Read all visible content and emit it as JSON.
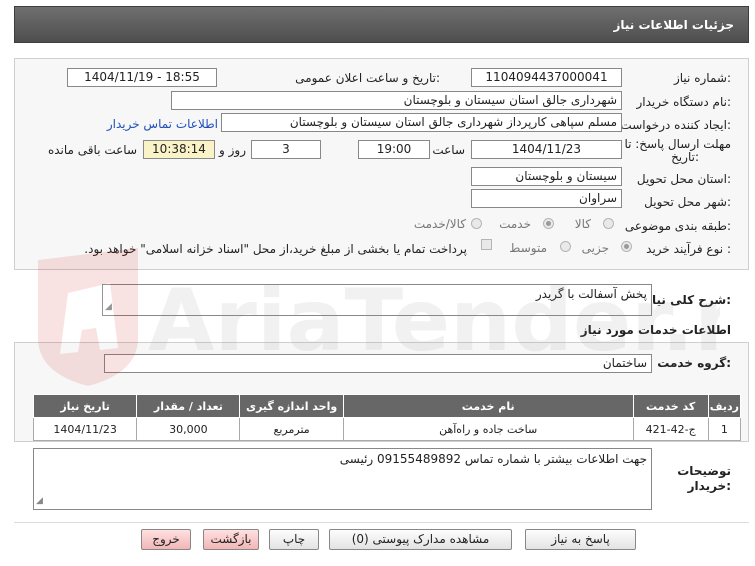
{
  "header": {
    "title": "جزئیات اطلاعات نیاز"
  },
  "form": {
    "need_number_label": "شماره نیاز:",
    "need_number": "1104094437000041",
    "announce_label": "تاریخ و ساعت اعلان عمومی:",
    "announce_value": "1404/11/19 - 18:55",
    "buyer_org_label": "نام دستگاه خریدار:",
    "buyer_org": "شهرداری جالق استان سیستان و بلوچستان",
    "creator_label": "ایجاد کننده درخواست:",
    "creator": "مسلم سپاهی کارپرداز شهرداری جالق استان سیستان و بلوچستان",
    "contact_link": "اطلاعات تماس خریدار",
    "deadline_label_1": "مهلت ارسال پاسخ: تا",
    "deadline_label_2": "تاریخ:",
    "deadline_date": "1404/11/23",
    "time_label": "ساعت",
    "deadline_time": "19:00",
    "days_value": "3",
    "days_label": "روز و",
    "remaining_time": "10:38:14",
    "remaining_label": "ساعت باقی مانده",
    "province_label": "استان محل تحویل:",
    "province": "سیستان و بلوچستان",
    "city_label": "شهر محل تحویل:",
    "city": "سراوان",
    "category_label": "طبقه بندی موضوعی:",
    "category_options": [
      "کالا",
      "خدمت",
      "کالا/خدمت"
    ],
    "process_label": "نوع فرآیند خرید :",
    "process_options": [
      "جزیی",
      "متوسط"
    ],
    "payment_note": "پرداخت تمام یا بخشی از مبلغ خرید،از محل \"اسناد خزانه اسلامی\" خواهد بود."
  },
  "summary": {
    "label": "شرح کلی نیاز:",
    "value": "پخش آسفالت با گریدر"
  },
  "services": {
    "section_title": "اطلاعات خدمات مورد نیاز",
    "group_label": "گروه خدمت:",
    "group_value": "ساختمان",
    "columns": [
      "ردیف",
      "کد خدمت",
      "نام خدمت",
      "واحد اندازه گیری",
      "تعداد / مقدار",
      "تاریخ نیاز"
    ],
    "rows": [
      [
        "1",
        "ج-42-421",
        "ساخت جاده و راه‌آهن",
        "مترمربع",
        "30,000",
        "1404/11/23"
      ]
    ]
  },
  "buyer_notes": {
    "label_1": "توضیحات",
    "label_2": "خریدار:",
    "value": "جهت اطلاعات بیشتر با شماره تماس 09155489892 رئیسی"
  },
  "buttons": {
    "reply": "پاسخ به نیاز",
    "view_docs": "مشاهده مدارک پیوستی (0)",
    "print": "چاپ",
    "back": "بازگشت",
    "exit": "خروج"
  },
  "watermark": {
    "text": "AriaTender.neT"
  }
}
